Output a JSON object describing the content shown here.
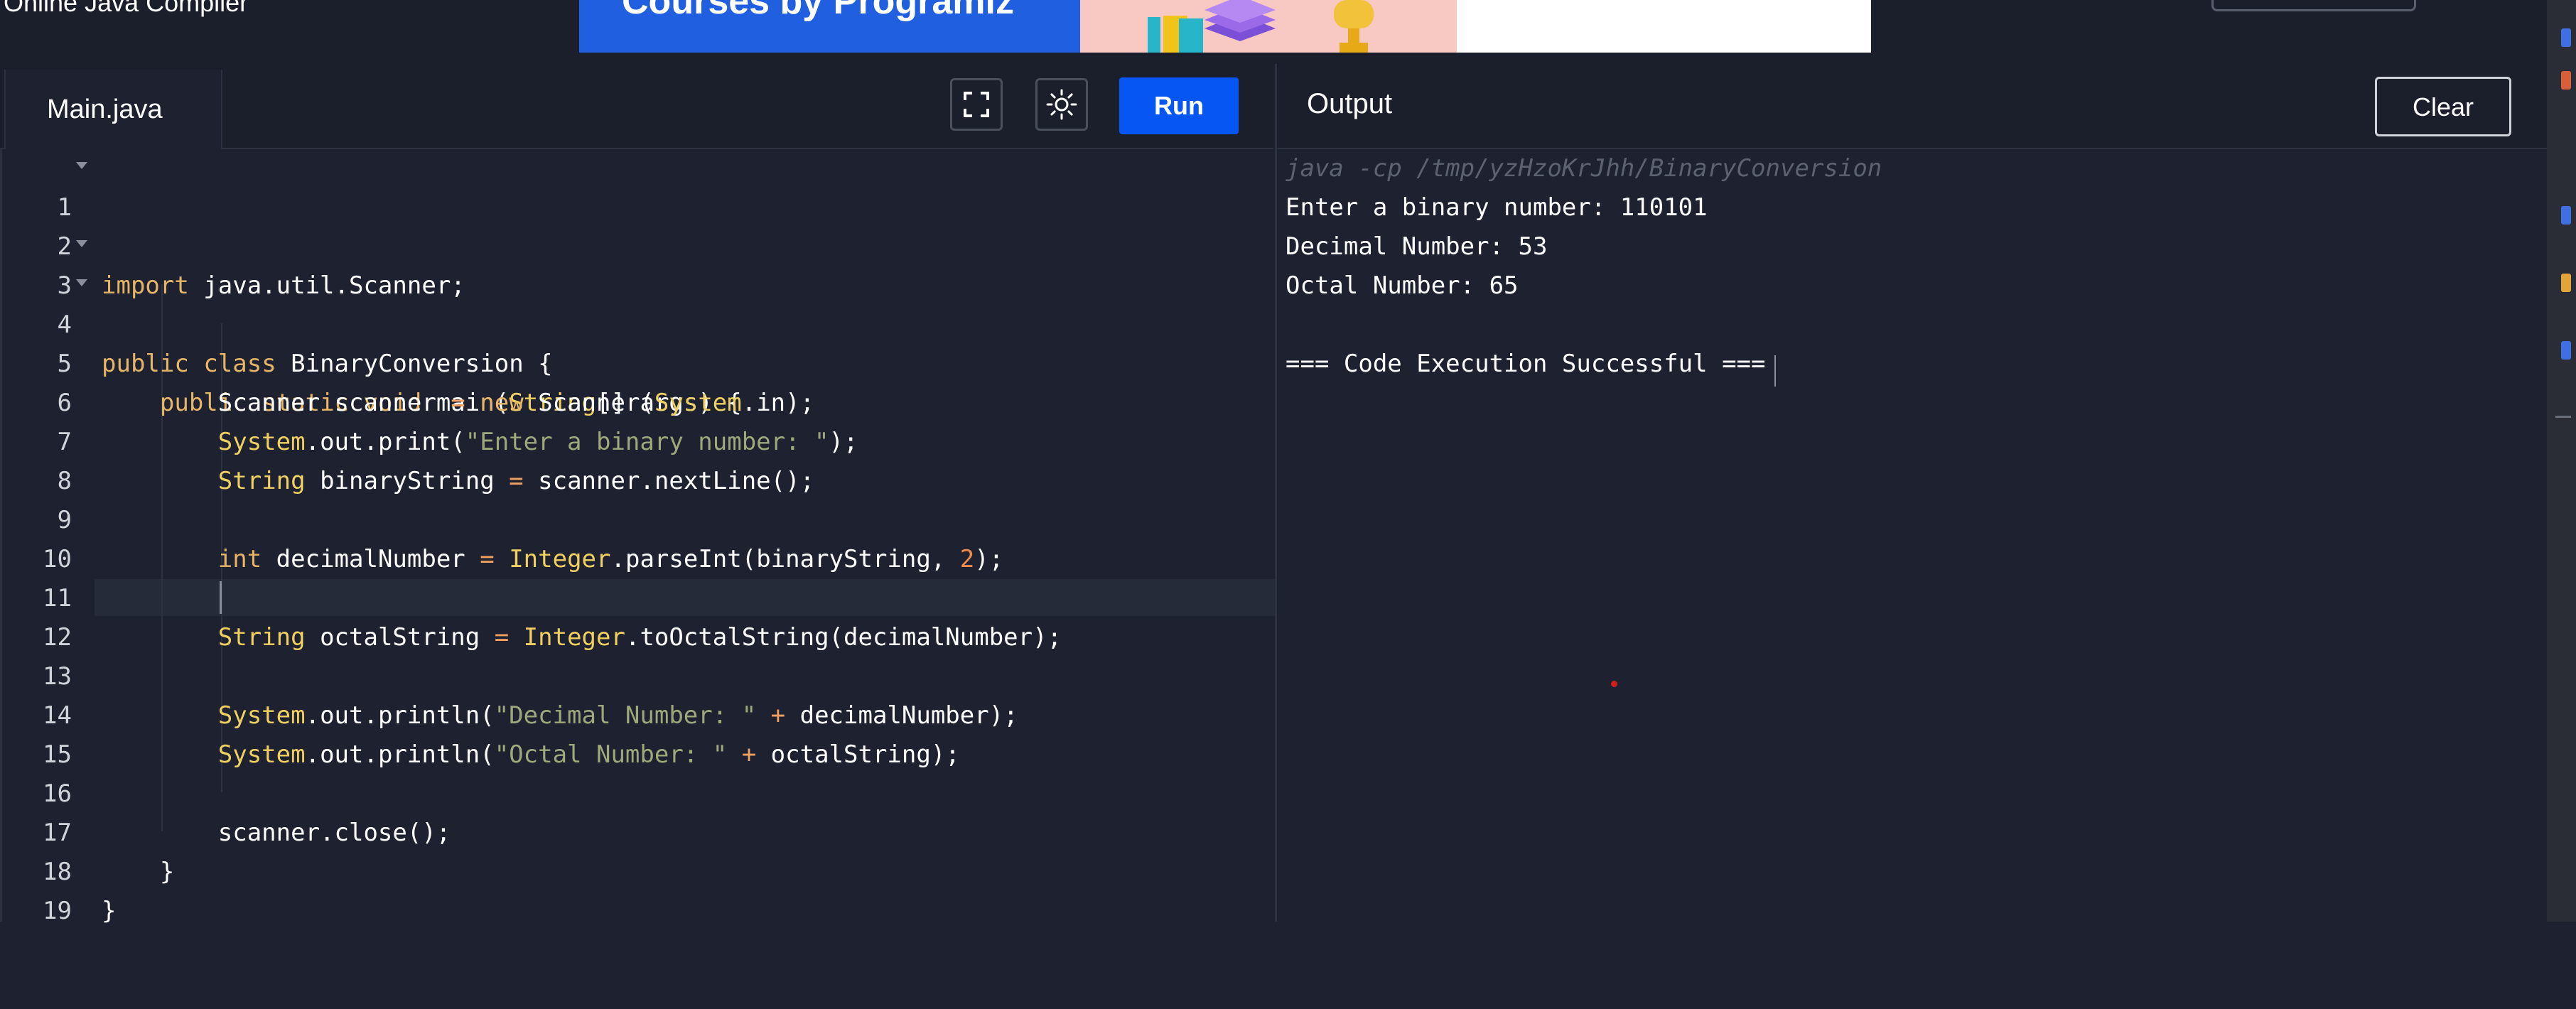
{
  "header": {
    "site_title": "Online Java Compiler",
    "ad_text": "Courses by Programiz"
  },
  "editor": {
    "file_tab": "Main.java",
    "run_label": "Run",
    "fullscreen_icon": "fullscreen-icon",
    "theme_icon": "sun-icon",
    "line_numbers": [
      "1",
      "2",
      "3",
      "4",
      "5",
      "6",
      "7",
      "8",
      "9",
      "10",
      "11",
      "12",
      "13",
      "14",
      "15",
      "16",
      "17",
      "18",
      "19"
    ]
  },
  "output": {
    "title": "Output",
    "clear_label": "Clear",
    "lines": [
      "java -cp /tmp/yzHzoKrJhh/BinaryConversion",
      "Enter a binary number: 110101",
      "Decimal Number: 53",
      "Octal Number: 65",
      "",
      "=== Code Execution Successful ==="
    ]
  },
  "colors": {
    "run_button": "#0556f3",
    "background": "#1d2130",
    "keyword": "#e6b566",
    "string": "#9ea87a"
  }
}
